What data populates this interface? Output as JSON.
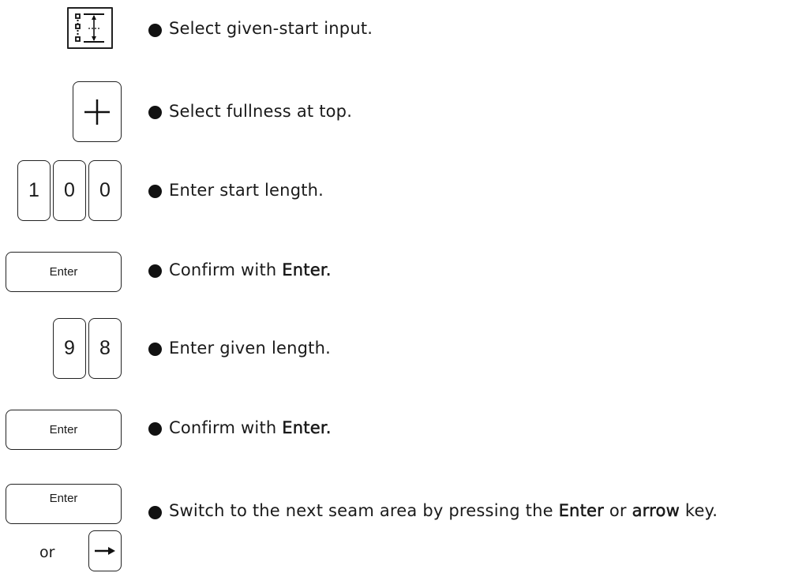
{
  "steps": [
    {
      "keys": [],
      "icon": "given-start-input-icon",
      "parts": [
        "Select given-start input."
      ]
    },
    {
      "keys": [],
      "icon": "plus-icon",
      "parts": [
        "Select fullness at top."
      ]
    },
    {
      "keys": [
        "1",
        "0",
        "0"
      ],
      "parts": [
        "Enter start length."
      ]
    },
    {
      "keys": [
        "Enter"
      ],
      "parts": [
        "Confirm with ",
        "Enter."
      ]
    },
    {
      "keys": [
        "9",
        "8"
      ],
      "parts": [
        "Enter given length."
      ]
    },
    {
      "keys": [
        "Enter"
      ],
      "parts": [
        "Confirm with ",
        "Enter."
      ]
    },
    {
      "keys": [
        "Enter"
      ],
      "or_label": "or",
      "alt_icon": "arrow-right-icon",
      "parts": [
        "Switch to the next seam area by pressing the ",
        "Enter",
        " or ",
        "arrow",
        " key."
      ]
    }
  ]
}
